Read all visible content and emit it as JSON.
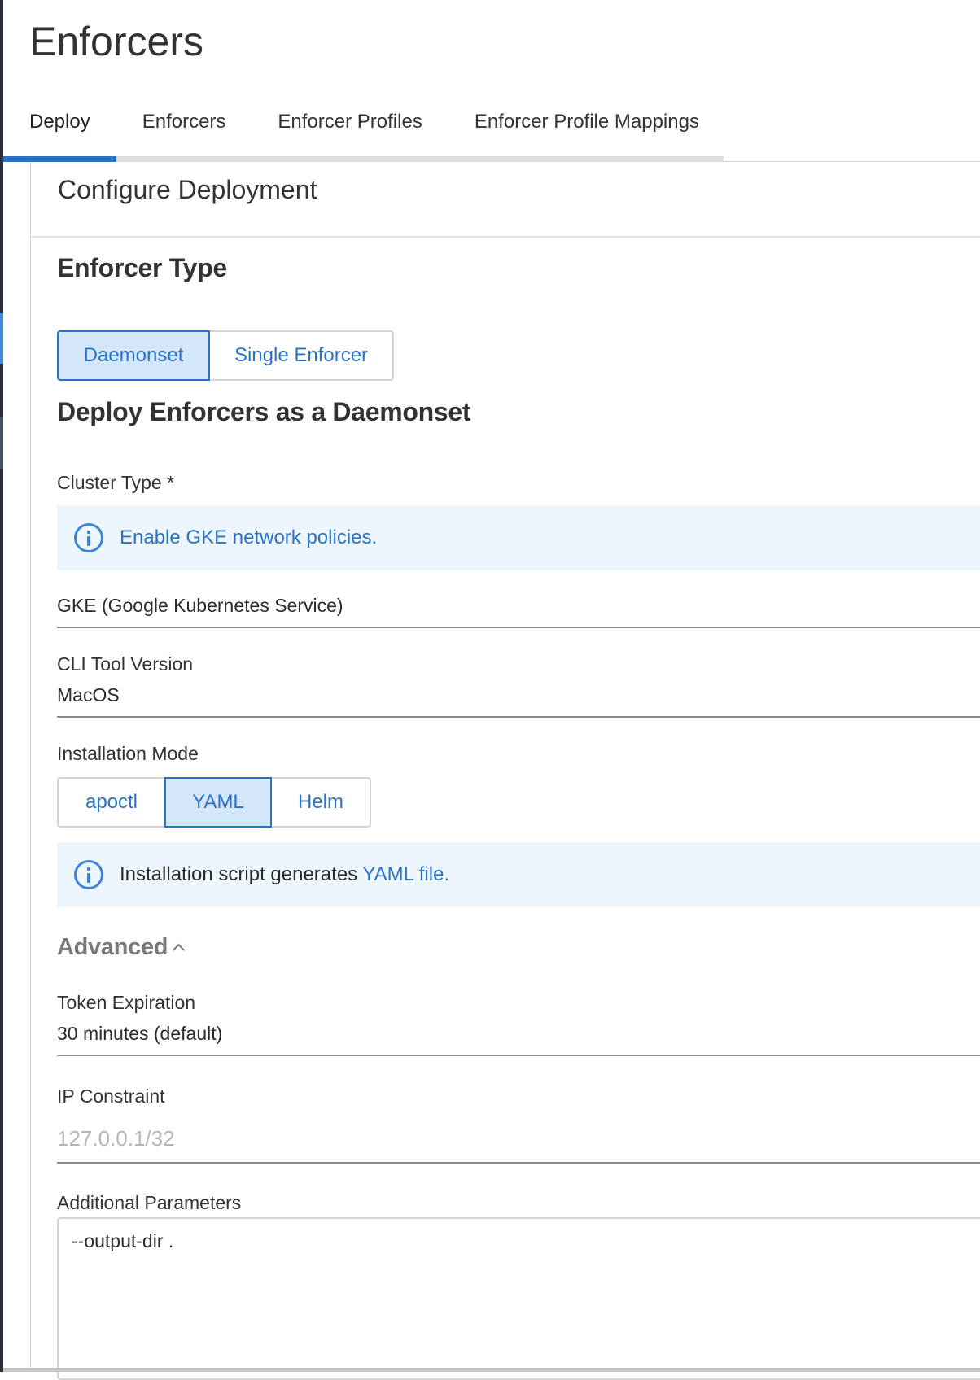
{
  "page": {
    "title": "Enforcers"
  },
  "tabs": [
    {
      "label": "Deploy",
      "active": true
    },
    {
      "label": "Enforcers",
      "active": false
    },
    {
      "label": "Enforcer Profiles",
      "active": false
    },
    {
      "label": "Enforcer Profile Mappings",
      "active": false
    }
  ],
  "section": {
    "title": "Configure Deployment"
  },
  "enforcer_type": {
    "heading": "Enforcer Type",
    "options": [
      {
        "label": "Daemonset",
        "selected": true
      },
      {
        "label": "Single Enforcer",
        "selected": false
      }
    ]
  },
  "daemonset": {
    "heading": "Deploy Enforcers as a Daemonset",
    "cluster_type": {
      "label": "Cluster Type *",
      "info_link": "Enable GKE network policies.",
      "value": "GKE (Google Kubernetes Service)"
    },
    "cli_tool": {
      "label": "CLI Tool Version",
      "value": "MacOS"
    },
    "installation_mode": {
      "label": "Installation Mode",
      "options": [
        {
          "label": "apoctl",
          "selected": false
        },
        {
          "label": "YAML",
          "selected": true
        },
        {
          "label": "Helm",
          "selected": false
        }
      ],
      "info_text": "Installation script generates ",
      "info_link": "YAML file."
    }
  },
  "advanced": {
    "label": "Advanced",
    "expanded": true,
    "token_expiration": {
      "label": "Token Expiration",
      "value": "30 minutes (default)"
    },
    "ip_constraint": {
      "label": "IP Constraint",
      "placeholder": "127.0.0.1/32"
    },
    "additional_parameters": {
      "label": "Additional Parameters",
      "value": "--output-dir ."
    }
  },
  "colors": {
    "accent": "#2a72c4",
    "selected_bg": "#d3e6fa",
    "info_bg": "#eef6fd"
  }
}
